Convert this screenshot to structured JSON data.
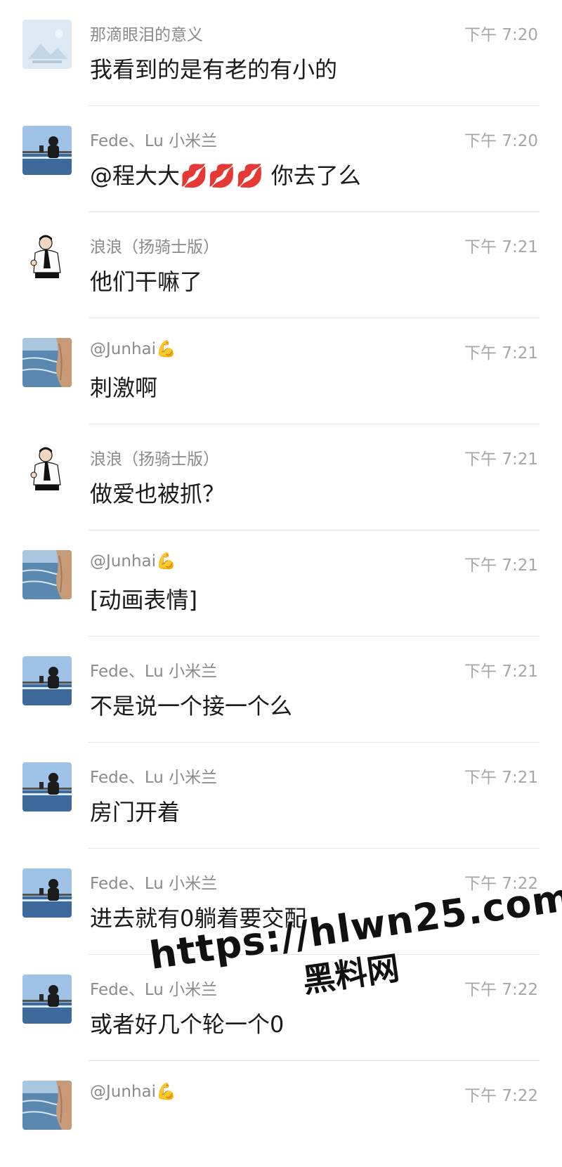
{
  "messages": [
    {
      "name": "那滴眼泪的意义",
      "time": "下午 7:20",
      "text": "我看到的是有老的有小的",
      "avatar": "landscape-placeholder"
    },
    {
      "name": "Fede、Lu 小米兰",
      "time": "下午 7:20",
      "text": "@程大大💋💋💋 你去了么",
      "avatar": "seaside-person"
    },
    {
      "name": "浪浪（扬骑士版）",
      "time": "下午 7:21",
      "text": "他们干嘛了",
      "avatar": "cartoon-man"
    },
    {
      "name": "@Junhai💪",
      "time": "下午 7:21",
      "text": "刺激啊",
      "avatar": "sea-arm"
    },
    {
      "name": "浪浪（扬骑士版）",
      "time": "下午 7:21",
      "text": "做爱也被抓？",
      "avatar": "cartoon-man"
    },
    {
      "name": "@Junhai💪",
      "time": "下午 7:21",
      "text": "[动画表情]",
      "avatar": "sea-arm"
    },
    {
      "name": "Fede、Lu 小米兰",
      "time": "下午 7:21",
      "text": "不是说一个接一个么",
      "avatar": "seaside-person"
    },
    {
      "name": "Fede、Lu 小米兰",
      "time": "下午 7:21",
      "text": "房门开着",
      "avatar": "seaside-person"
    },
    {
      "name": "Fede、Lu 小米兰",
      "time": "下午 7:22",
      "text": "进去就有0躺着要交配",
      "avatar": "seaside-person"
    },
    {
      "name": "Fede、Lu 小米兰",
      "time": "下午 7:22",
      "text": "或者好几个轮一个0",
      "avatar": "seaside-person"
    },
    {
      "name": "@Junhai💪",
      "time": "下午 7:22",
      "text": "",
      "avatar": "sea-arm"
    }
  ],
  "watermark": {
    "line1": "https://hlwn25.com",
    "line2": "黑料网"
  },
  "colors": {
    "name": "#8a8a8a",
    "time": "#a6a6a6",
    "message": "#1a1a1a",
    "divider": "#e5e5e5"
  }
}
